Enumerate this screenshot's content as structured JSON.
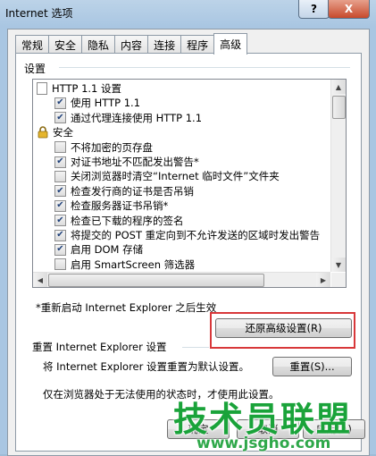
{
  "window": {
    "title": "Internet 选项",
    "help_symbol": "?",
    "close_symbol": "X"
  },
  "tabs": [
    {
      "label": "常规",
      "active": false
    },
    {
      "label": "安全",
      "active": false
    },
    {
      "label": "隐私",
      "active": false
    },
    {
      "label": "内容",
      "active": false
    },
    {
      "label": "连接",
      "active": false
    },
    {
      "label": "程序",
      "active": false
    },
    {
      "label": "高级",
      "active": true
    }
  ],
  "settings": {
    "group_label": "设置",
    "items": [
      {
        "type": "header",
        "icon": "document-icon",
        "label": "HTTP 1.1 设置"
      },
      {
        "type": "checkbox",
        "checked": true,
        "label": "使用 HTTP 1.1"
      },
      {
        "type": "checkbox",
        "checked": true,
        "label": "通过代理连接使用 HTTP 1.1"
      },
      {
        "type": "header",
        "icon": "lock-icon",
        "label": "安全"
      },
      {
        "type": "checkbox",
        "checked": false,
        "label": "不将加密的页存盘"
      },
      {
        "type": "checkbox",
        "checked": true,
        "label": "对证书地址不匹配发出警告*"
      },
      {
        "type": "checkbox",
        "checked": false,
        "label": "关闭浏览器时清空“Internet 临时文件”文件夹"
      },
      {
        "type": "checkbox",
        "checked": true,
        "label": "检查发行商的证书是否吊销"
      },
      {
        "type": "checkbox",
        "checked": true,
        "label": "检查服务器证书吊销*"
      },
      {
        "type": "checkbox",
        "checked": true,
        "label": "检查已下载的程序的签名"
      },
      {
        "type": "checkbox",
        "checked": true,
        "label": "将提交的 POST 重定向到不允许发送的区域时发出警告"
      },
      {
        "type": "checkbox",
        "checked": true,
        "label": "启用 DOM 存储"
      },
      {
        "type": "checkbox",
        "checked": false,
        "label": "启用 SmartScreen 筛选器"
      }
    ],
    "restart_note": "*重新启动 Internet Explorer 之后生效",
    "restore_button": "还原高级设置(R)"
  },
  "reset": {
    "section_title": "重置 Internet Explorer 设置",
    "description": "将 Internet Explorer 设置重置为默认设置。",
    "button": "重置(S)...",
    "note": "仅在浏览器处于无法使用的状态时，才使用此设置。"
  },
  "footer": {
    "ok": "确定",
    "cancel": "取消",
    "apply": "应用(A)"
  },
  "watermark": {
    "title": "技术员联盟",
    "url": "www.jsgho.com"
  },
  "colors": {
    "highlight_box": "#d8383a",
    "watermark": "#1aa33a",
    "check": "#21427a"
  }
}
